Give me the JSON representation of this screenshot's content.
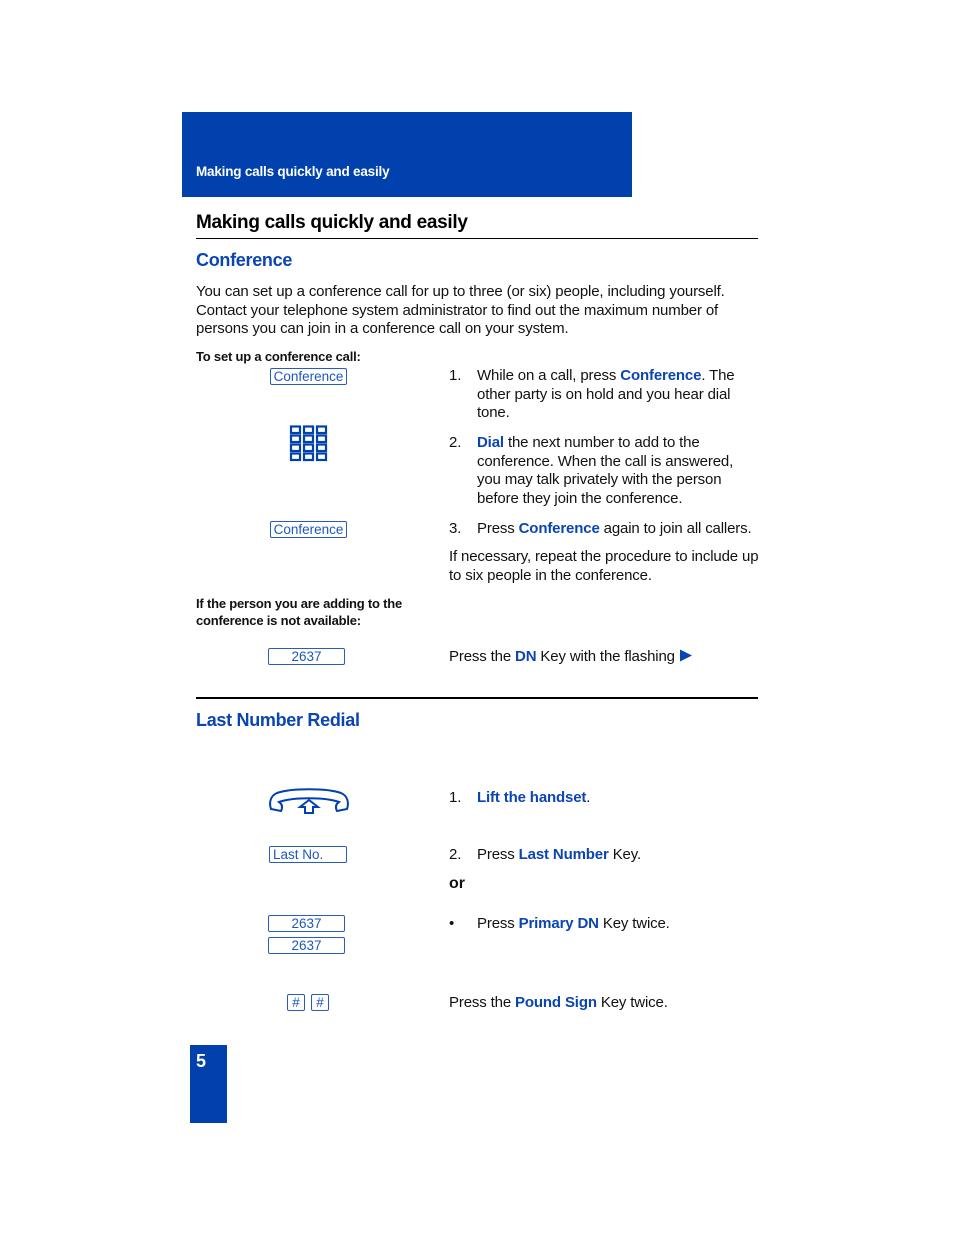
{
  "header": {
    "running_title": "Making calls quickly and easily"
  },
  "section_title": "Making calls quickly and easily",
  "conference": {
    "title": "Conference",
    "intro": "You can set up a conference call for up to three (or six) people, including yourself. Contact your telephone system administrator to find out the maximum number of persons you can join in a conference call on your system.",
    "setup_label": "To set up a conference call:",
    "keys": {
      "conference_key_1": "Conference",
      "dialpad_icon": "dialpad-icon",
      "conference_key_2": "Conference"
    },
    "steps": [
      {
        "num": "1.",
        "pre": "While on a call, press ",
        "hl": "Conference",
        "post": ". The other party is on hold and you hear dial tone."
      },
      {
        "num": "2.",
        "pre": "",
        "hl": "Dial",
        "post": " the next number to add to the conference. When the call is answered, you may talk privately with the person before they join the conference."
      },
      {
        "num": "3.",
        "pre": "Press ",
        "hl": "Conference",
        "post": " again to join all callers."
      }
    ],
    "repeat_note": "If necessary, repeat the procedure to include up to six people in the conference.",
    "unavailable_label": "If the person you are adding to the conference is not available:",
    "dn_key": "2637",
    "dn_instruction": {
      "pre": "Press the ",
      "hl": "DN",
      "post": " Key with the flashing ",
      "icon": "play-triangle-icon"
    }
  },
  "last_number_redial": {
    "title": "Last Number Redial",
    "handset_icon": "lift-handset-icon",
    "steps": [
      {
        "num": "1.",
        "pre": "",
        "hl": "Lift the handset",
        "post": "."
      },
      {
        "num": "2.",
        "pre": "Press ",
        "hl": "Last Number",
        "post": " Key."
      }
    ],
    "last_no_key": "Last No.",
    "or_label": "or",
    "bullet": {
      "num": "•",
      "pre": "Press ",
      "hl": "Primary DN",
      "post": " Key twice."
    },
    "primary_dn_keys": [
      "2637",
      "2637"
    ],
    "pound_keys": [
      "#",
      "#"
    ],
    "pound_instruction": {
      "pre": "Press the ",
      "hl": "Pound Sign",
      "post": " Key twice."
    }
  },
  "page_number": "5",
  "colors": {
    "brand_blue": "#0041ad",
    "highlight_blue": "#0b45b3",
    "key_blue": "#1e56c0"
  }
}
